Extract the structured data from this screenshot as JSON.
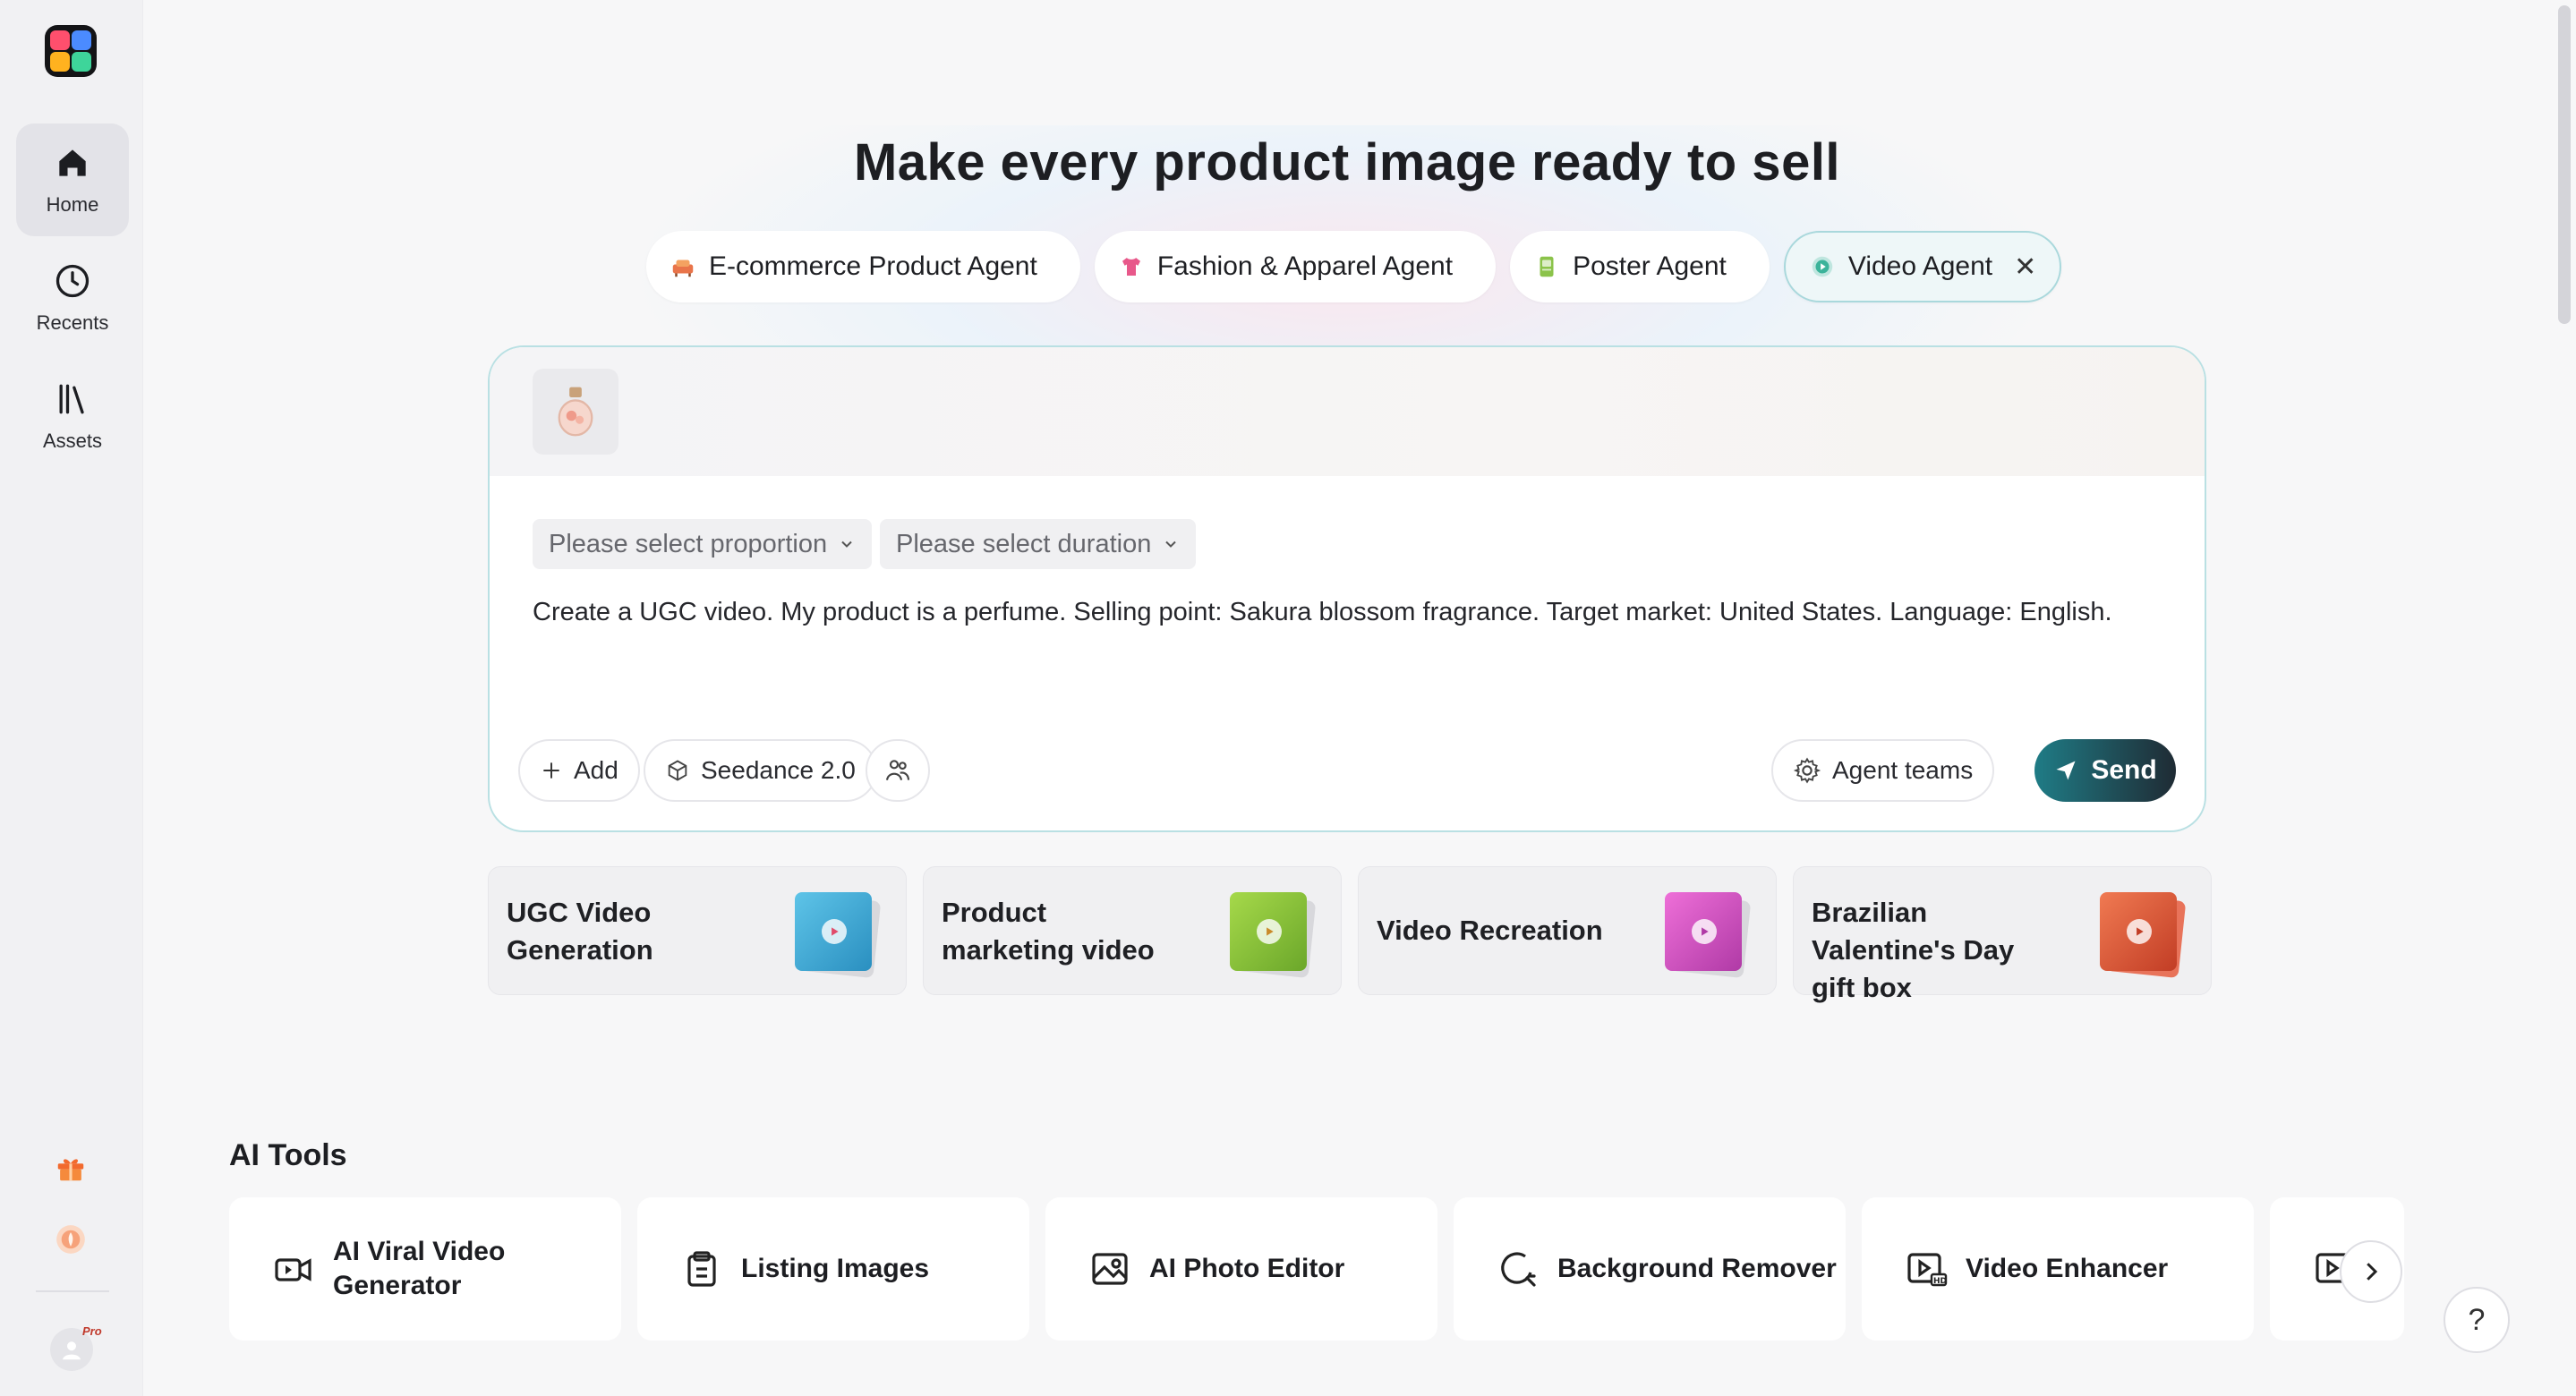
{
  "sidebar": {
    "items": [
      {
        "label": "Home",
        "icon": "home-icon",
        "active": true
      },
      {
        "label": "Recents",
        "icon": "clock-icon",
        "active": false
      },
      {
        "label": "Assets",
        "icon": "library-icon",
        "active": false
      }
    ],
    "pro_badge": "Pro"
  },
  "main": {
    "headline": "Make every product image ready to sell",
    "agent_tabs": [
      {
        "label": "E-commerce Product Agent",
        "icon": "sofa-icon"
      },
      {
        "label": "Fashion & Apparel Agent",
        "icon": "tshirt-icon"
      },
      {
        "label": "Poster Agent",
        "icon": "poster-icon"
      },
      {
        "label": "Video Agent",
        "icon": "video-agent-icon",
        "active": true
      }
    ],
    "composer": {
      "proportion_placeholder": "Please select proportion",
      "duration_placeholder": "Please select duration",
      "prompt": "Create a UGC video. My product is a perfume. Selling point: Sakura blossom fragrance. Target market: United States. Language: English.",
      "add_label": "Add",
      "model_label": "Seedance 2.0",
      "agent_teams_label": "Agent teams",
      "send_label": "Send"
    },
    "suggestions": [
      {
        "label": "UGC Video Generation",
        "color": "#3fb2d8"
      },
      {
        "label": "Product marketing video",
        "color": "#8fc63f"
      },
      {
        "label": "Video Recreation",
        "color": "#d94fc7"
      },
      {
        "label": "Brazilian Valentine's Day gift box",
        "color": "#e0553a"
      }
    ],
    "ai_tools": {
      "title": "AI Tools",
      "items": [
        {
          "label": "AI Viral Video Generator",
          "icon": "video-camera-icon"
        },
        {
          "label": "Listing Images",
          "icon": "listing-icon"
        },
        {
          "label": "AI Photo Editor",
          "icon": "photo-icon"
        },
        {
          "label": "Background Remover",
          "icon": "background-remover-icon"
        },
        {
          "label": "Video Enhancer",
          "icon": "video-hd-icon"
        }
      ]
    },
    "help_label": "?"
  }
}
